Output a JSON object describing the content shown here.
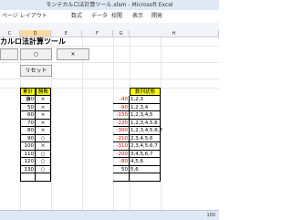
{
  "window_title": "モンテカルロ法計算ツール.xlsm - Microsoft Excel",
  "ribbon_tabs": [
    "ページ レイアウト",
    "数式",
    "データ",
    "校閲",
    "表示",
    "開発"
  ],
  "columns": [
    "C",
    "D",
    "E",
    "F",
    "G",
    "H"
  ],
  "sheet_title": "カルロ法計算ツール",
  "buttons": {
    "circle": "○",
    "cross": "×",
    "reset": "リセット"
  },
  "headers": {
    "cumulative": "累計金",
    "win_loss": "勝敗",
    "number_list": "数列状態"
  },
  "rows": [
    {
      "cumulative": "40",
      "result": "×",
      "number": "-40",
      "sequence": "1,2,3"
    },
    {
      "cumulative": "50",
      "result": "×",
      "number": "-90",
      "sequence": "1,2,3,4"
    },
    {
      "cumulative": "60",
      "result": "×",
      "number": "-150",
      "sequence": "1,2,3,4,5"
    },
    {
      "cumulative": "70",
      "result": "×",
      "number": "-220",
      "sequence": "1,2,3,4,5,6"
    },
    {
      "cumulative": "80",
      "result": "×",
      "number": "-300",
      "sequence": "1,2,3,4,5,6,7"
    },
    {
      "cumulative": "90",
      "result": "○",
      "number": "-210",
      "sequence": "2,3,4,5,6"
    },
    {
      "cumulative": "100",
      "result": "×",
      "number": "-310",
      "sequence": "2,3,4,5,6,7"
    },
    {
      "cumulative": "110",
      "result": "○",
      "number": "-200",
      "sequence": "3,4,5,6,7"
    },
    {
      "cumulative": "120",
      "result": "○",
      "number": "-80",
      "sequence": "4,5,6"
    },
    {
      "cumulative": "130",
      "result": "○",
      "number": "50",
      "sequence": "5,6"
    }
  ],
  "zoom": "100"
}
